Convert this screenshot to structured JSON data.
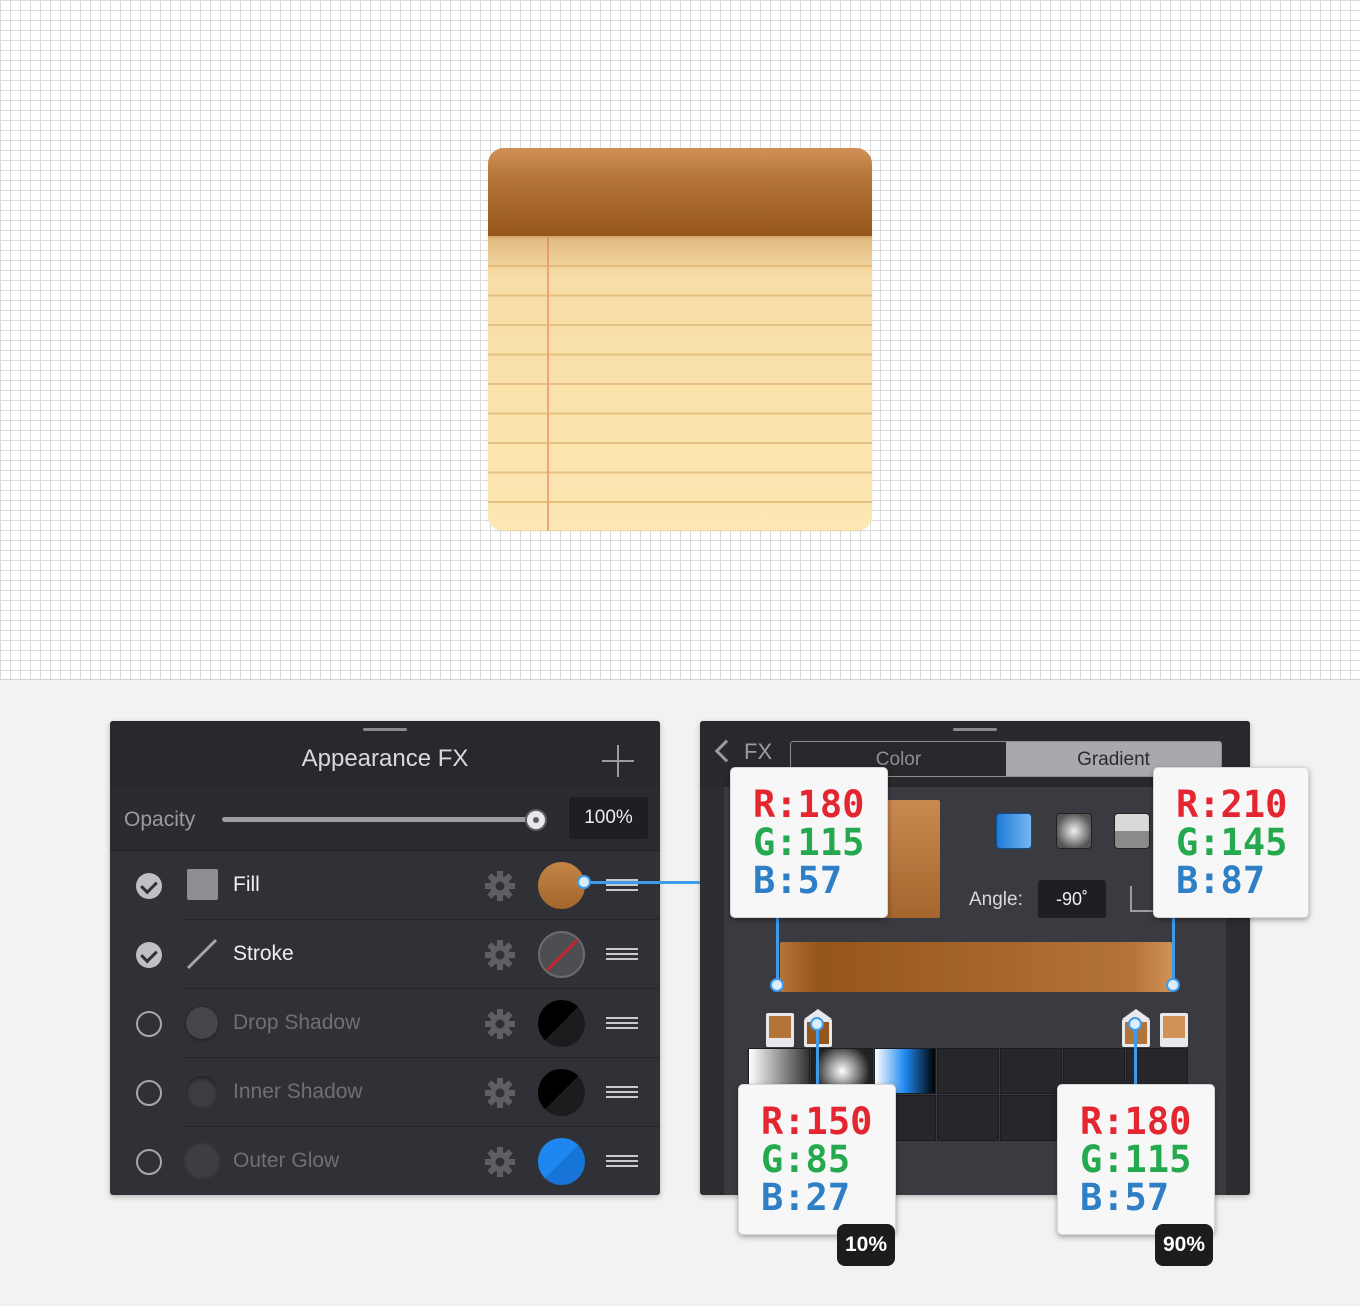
{
  "colors": {
    "notepad_header_top": "#D29157",
    "notepad_header_bottom": "#965519",
    "paper": "#FBE3A8",
    "margin_line": "#F2A37E",
    "accent_blue": "#3D9BEA"
  },
  "appearance_panel": {
    "title": "Appearance FX",
    "opacity_label": "Opacity",
    "opacity_value": "100%",
    "opacity_fraction": 1.0,
    "effects": [
      {
        "label": "Fill",
        "enabled": true,
        "icon": "square-icon",
        "swatch": "#B47339"
      },
      {
        "label": "Stroke",
        "enabled": true,
        "icon": "line-icon",
        "swatch": "none"
      },
      {
        "label": "Drop Shadow",
        "enabled": false,
        "icon": "circle-icon",
        "swatch": "#000000"
      },
      {
        "label": "Inner Shadow",
        "enabled": false,
        "icon": "circle-icon",
        "swatch": "#000000"
      },
      {
        "label": "Outer Glow",
        "enabled": false,
        "icon": "circle-icon",
        "swatch": "#1E88F0"
      }
    ]
  },
  "gradient_panel": {
    "back_label": "FX",
    "tabs": [
      "Color",
      "Gradient"
    ],
    "active_tab": "Gradient",
    "angle_label": "Angle:",
    "angle_value": "-90˚",
    "gradient_types": [
      "linear-gradient-icon",
      "radial-gradient-icon",
      "conical-gradient-icon"
    ],
    "stops": [
      {
        "position": 0,
        "color": "#B47339"
      },
      {
        "position": 10,
        "color": "#965519"
      },
      {
        "position": 90,
        "color": "#B47339"
      },
      {
        "position": 100,
        "color": "#D29157"
      }
    ]
  },
  "callouts": [
    {
      "r": "R:180",
      "g": "G:115",
      "b": "B:57"
    },
    {
      "r": "R:210",
      "g": "G:145",
      "b": "B:87"
    },
    {
      "r": "R:150",
      "g": "G:85",
      "b": "B:27",
      "badge": "10%"
    },
    {
      "r": "R:180",
      "g": "G:115",
      "b": "B:57",
      "badge": "90%"
    }
  ]
}
